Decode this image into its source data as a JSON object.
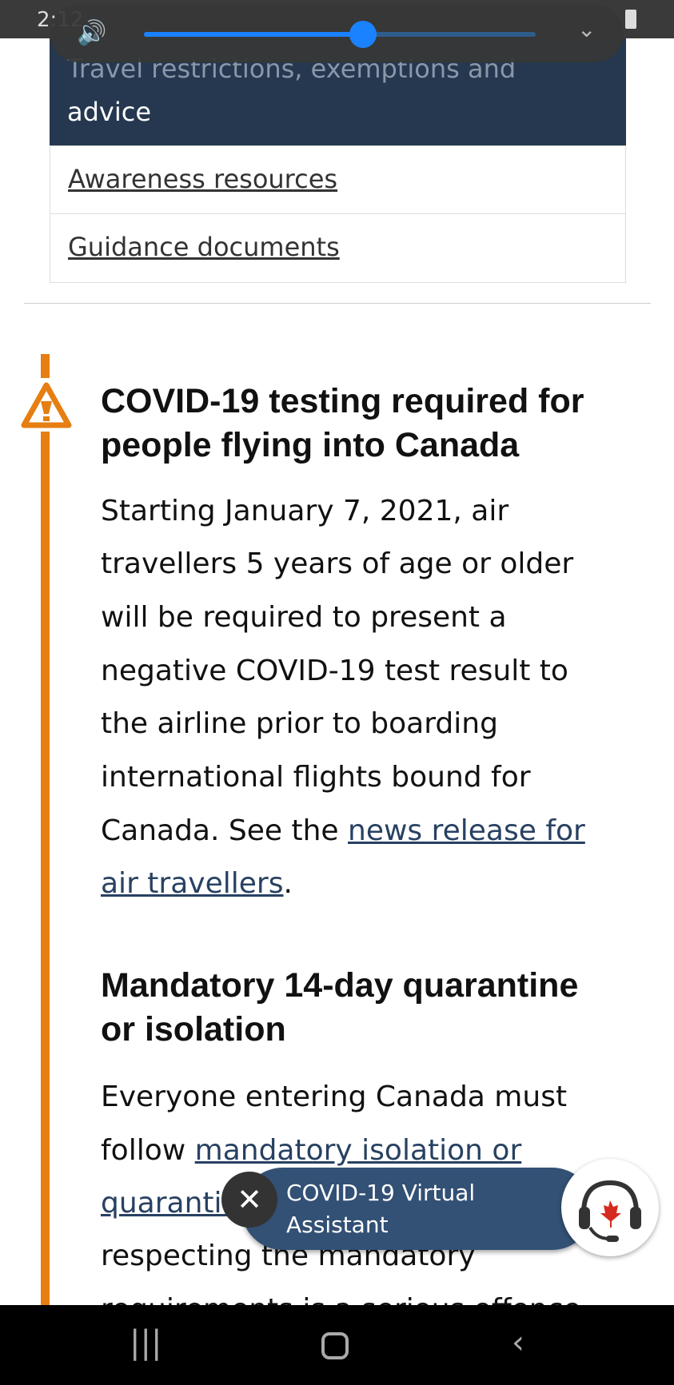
{
  "status_bar": {
    "time": "2:12"
  },
  "volume": {
    "level_percent": 56
  },
  "nav_menu": {
    "active_item_lines": [
      "Travel restrictions, exemptions and",
      "advice"
    ],
    "items": [
      "Awareness resources",
      "Guidance documents"
    ]
  },
  "alert": {
    "color": "#e67e12",
    "heading_lines": [
      "COVID-19 testing required for",
      "people flying into Canada"
    ],
    "body_lines": [
      "Starting January 7, 2021, air",
      "travellers 5 years of age or older",
      "will be required to present a",
      "negative COVID-19 test result to",
      "the airline prior to boarding",
      "international flights bound for"
    ],
    "body_line7_prefix": "Canada. See the ",
    "link_part1": "news release for",
    "link_part2": "air travellers",
    "period": "."
  },
  "quarantine": {
    "heading_lines": [
      "Mandatory 14-day quarantine",
      "or isolation"
    ],
    "line1": "Everyone entering Canada must",
    "line2_prefix": "follow ",
    "link_part1": "mandatory isolation or",
    "link_part2": "quarantine",
    "line3": "respecting the mandatory",
    "line4": "requirements is a serious offence"
  },
  "assistant": {
    "label_lines": [
      "COVID-19 Virtual",
      "Assistant"
    ],
    "close": "✕"
  }
}
